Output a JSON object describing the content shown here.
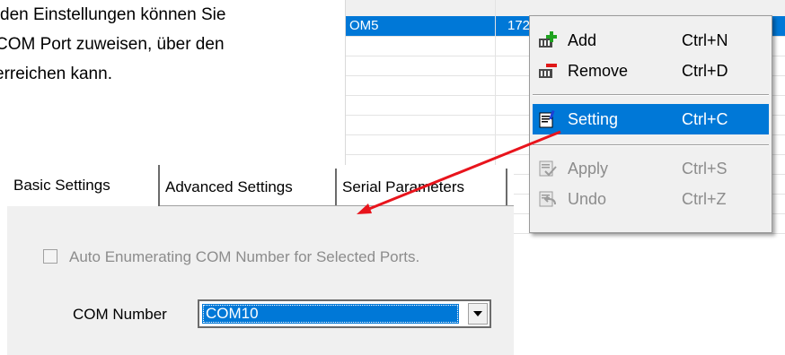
{
  "intro": {
    "line1": "den Einstellungen können Sie",
    "line2": "COM Port zuweisen, über den",
    "line3": "erreichen kann."
  },
  "port_list": {
    "selected_row": {
      "port": "OM5",
      "ip": "172"
    }
  },
  "context_menu": {
    "items": [
      {
        "label": "Add",
        "shortcut": "Ctrl+N",
        "icon": "add-port-icon",
        "state": "enabled"
      },
      {
        "label": "Remove",
        "shortcut": "Ctrl+D",
        "icon": "remove-port-icon",
        "state": "enabled"
      },
      {
        "label": "Setting",
        "shortcut": "Ctrl+C",
        "icon": "setting-icon",
        "state": "highlighted"
      },
      {
        "label": "Apply",
        "shortcut": "Ctrl+S",
        "icon": "apply-icon",
        "state": "disabled"
      },
      {
        "label": "Undo",
        "shortcut": "Ctrl+Z",
        "icon": "undo-icon",
        "state": "disabled"
      }
    ]
  },
  "dialog": {
    "tabs": [
      {
        "label": "Basic Settings",
        "active": true
      },
      {
        "label": "Advanced Settings",
        "active": false
      },
      {
        "label": "Serial Parameters",
        "active": false
      }
    ],
    "auto_enum_label": "Auto Enumerating COM Number for Selected Ports.",
    "auto_enum_checked": false,
    "auto_enum_enabled": false,
    "com_number_label": "COM Number",
    "com_number_value": "COM10"
  },
  "colors": {
    "selection_blue": "#0078d7",
    "menu_background": "#f0f0f0",
    "annotation_arrow": "#e8141c"
  }
}
